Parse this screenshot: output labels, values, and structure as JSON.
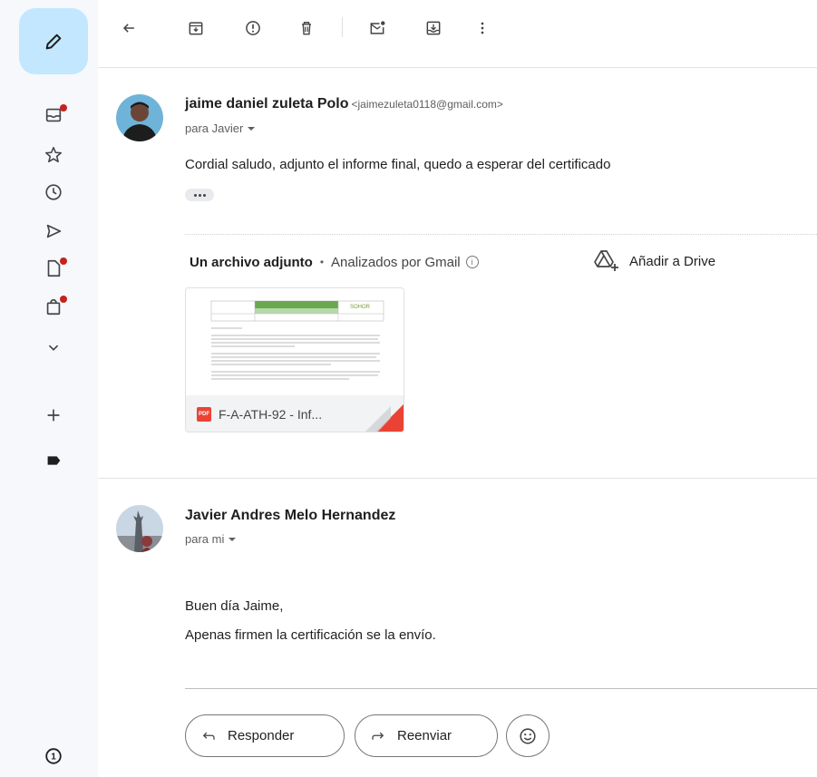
{
  "rail": {
    "compose_icon": "pencil-icon",
    "items": [
      {
        "icon": "inbox-icon",
        "badge": true
      },
      {
        "icon": "star-icon",
        "badge": false
      },
      {
        "icon": "clock-icon",
        "badge": false
      },
      {
        "icon": "send-icon",
        "badge": false
      },
      {
        "icon": "draft-icon",
        "badge": true
      },
      {
        "icon": "shopping-bag-icon",
        "badge": true
      },
      {
        "icon": "chevron-down-icon",
        "badge": false
      }
    ],
    "footer_badge": "1"
  },
  "toolbar": {
    "icons": [
      "back-arrow-icon",
      "archive-icon",
      "report-spam-icon",
      "delete-icon",
      "mark-unread-icon",
      "move-to-icon",
      "more-vert-icon"
    ]
  },
  "message1": {
    "sender_name": "jaime daniel zuleta Polo",
    "sender_email": "<jaimezuleta0118@gmail.com>",
    "to": "para Javier",
    "body": "Cordial saludo, adjunto el informe final, quedo a esperar del certificado"
  },
  "attachment": {
    "count_label": "Un archivo adjunto",
    "separator": "•",
    "scan_label": "Analizados por Gmail",
    "info_glyph": "i",
    "drive_label": "Añadir a Drive",
    "file_name": "F-A-ATH-92 - Inf...",
    "file_type": "PDF",
    "preview_brand": "SOHOR"
  },
  "message2": {
    "sender_name": "Javier Andres Melo Hernandez",
    "to": "para mi",
    "body_line1": "Buen día Jaime,",
    "body_line2": "Apenas firmen la certificación se la envío."
  },
  "actions": {
    "reply_label": "Responder",
    "forward_label": "Reenviar"
  },
  "colors": {
    "compose_bg": "#c2e7ff",
    "rail_bg": "#f6f8fc",
    "badge_red": "#c5221f",
    "pdf_red": "#ea4335"
  }
}
